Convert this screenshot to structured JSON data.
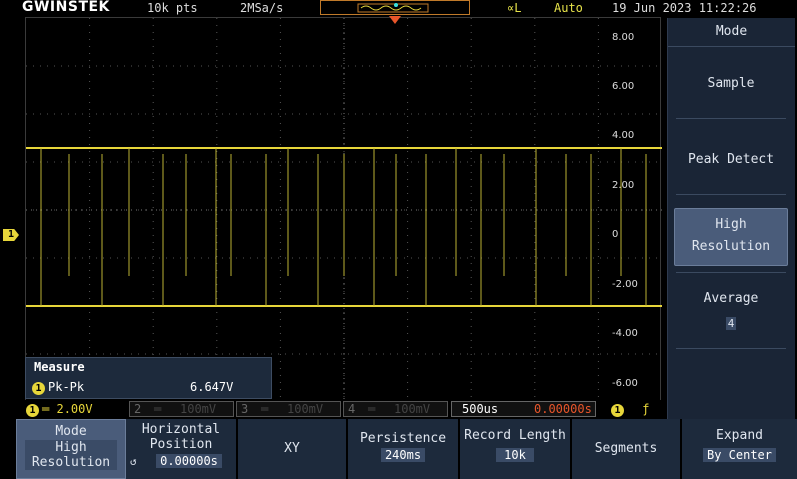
{
  "top": {
    "brand": "GWINSTEK",
    "memory_depth": "10k pts",
    "sample_rate": "2MSa/s",
    "trigger_symbol": "∝L",
    "trigger_mode": "Auto",
    "datetime": "19 Jun 2023 11:22:26"
  },
  "channel_marker": "1",
  "grid_labels": [
    "8.00",
    "6.00",
    "4.00",
    "2.00",
    "0",
    "-2.00",
    "-4.00",
    "-6.00"
  ],
  "measure": {
    "title": "Measure",
    "channel": "1",
    "name": "Pk-Pk",
    "value": "6.647V"
  },
  "status": {
    "ch1": {
      "num": "1",
      "scale": "2.00V"
    },
    "ch2": {
      "num": "2",
      "scale": "100mV"
    },
    "ch3": {
      "num": "3",
      "scale": "100mV"
    },
    "ch4": {
      "num": "4",
      "scale": "100mV"
    },
    "timebase": "500us",
    "position": "0.00000s",
    "trig_ch": "1",
    "trig_slope": "ƒ"
  },
  "side_menu": {
    "header": "Mode",
    "items": [
      "Sample",
      "Peak Detect",
      "High",
      "Resolution",
      "Average",
      "4"
    ]
  },
  "bottom_menu": {
    "mode": {
      "label": "Mode",
      "value1": "High",
      "value2": "Resolution"
    },
    "horizontal": {
      "label1": "Horizontal",
      "label2": "Position",
      "value": "0.00000s"
    },
    "xy": {
      "label": "XY"
    },
    "persistence": {
      "label": "Persistence",
      "value": "240ms"
    },
    "record_length": {
      "label": "Record Length",
      "value": "10k"
    },
    "segments": {
      "label": "Segments"
    },
    "expand": {
      "label": "Expand",
      "value": "By Center"
    }
  },
  "colors": {
    "ch1": "#e7d63a",
    "trigger": "#e8552a",
    "panel": "#1d2a3c"
  }
}
